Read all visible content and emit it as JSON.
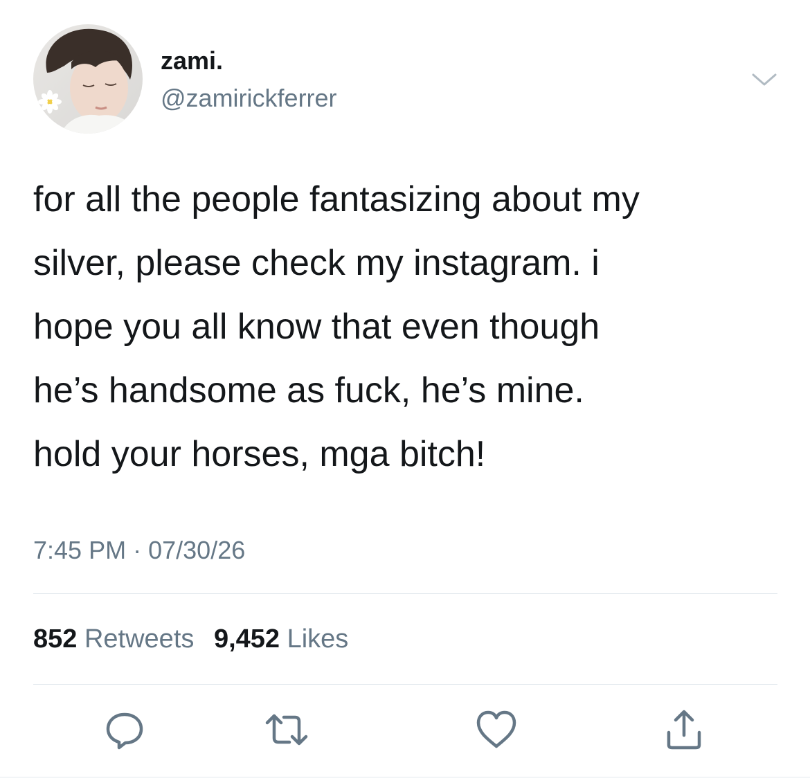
{
  "user": {
    "display_name": "zami.",
    "handle": "@zamirickferrer",
    "avatar_icon": "profile-photo"
  },
  "tweet": {
    "lines": [
      "for all the people fantasizing about my",
      "silver, please check my instagram. i",
      "hope you all know that even though",
      "he’s handsome as fuck, he’s mine.",
      "hold your horses, mga bitch!"
    ],
    "time": "7:45 PM",
    "separator": "·",
    "date": "07/30/26"
  },
  "stats": {
    "retweets_count": "852",
    "retweets_label": "Retweets",
    "likes_count": "9,452",
    "likes_label": "Likes"
  },
  "actions": {
    "reply_icon": "reply-icon",
    "retweet_icon": "retweet-icon",
    "like_icon": "heart-icon",
    "share_icon": "share-icon"
  },
  "colors": {
    "text_primary": "#14171a",
    "text_secondary": "#657786",
    "divider": "#e1e8ed",
    "icon": "#657786"
  }
}
